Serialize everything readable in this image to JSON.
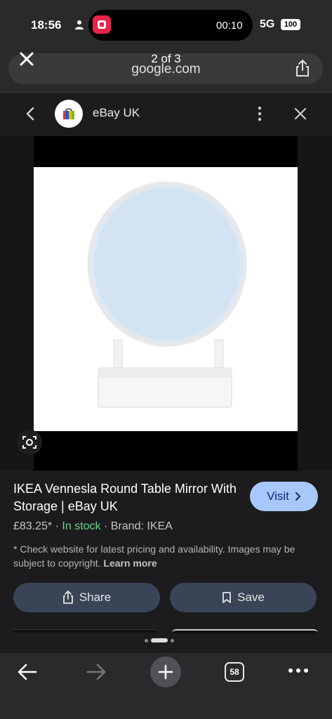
{
  "status_bar": {
    "time": "18:56",
    "island_time": "00:10",
    "signal": "5G",
    "battery": "100",
    "app_icon": "video-app-icon"
  },
  "browser": {
    "page_counter": "2 of 3",
    "url": "google.com"
  },
  "site_header": {
    "site_name": "eBay UK",
    "logo_icon": "shopping-bag-icon"
  },
  "result": {
    "title": "IKEA Vennesla Round Table Mirror With Storage | eBay UK",
    "visit_label": "Visit",
    "price": "£83.25*",
    "stock": "In stock",
    "brand": "Brand: IKEA",
    "disclaimer": "* Check website for latest pricing and availability. Images may be subject to copyright.",
    "learn_more": "Learn more",
    "share_label": "Share",
    "save_label": "Save"
  },
  "bottom_nav": {
    "tab_count": "58"
  },
  "colors": {
    "visit_bg": "#a8c7fa",
    "in_stock": "#6dd58c",
    "action_btn_bg": "#394457"
  }
}
